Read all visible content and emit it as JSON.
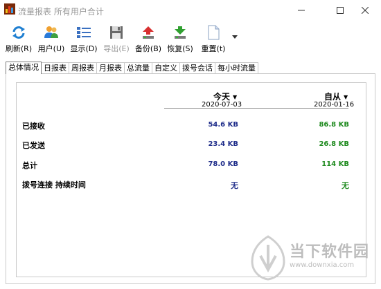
{
  "window": {
    "title": "流量报表 所有用户合计"
  },
  "toolbar": {
    "buttons": [
      {
        "label": "刷新(R)",
        "icon": "refresh-icon"
      },
      {
        "label": "用户(U)",
        "icon": "users-icon"
      },
      {
        "label": "显示(D)",
        "icon": "display-list-icon"
      },
      {
        "label": "导出(E)",
        "icon": "save-disk-icon",
        "disabled": true
      },
      {
        "label": "备份(B)",
        "icon": "backup-up-arrow-icon"
      },
      {
        "label": "恢复(S)",
        "icon": "restore-down-arrow-icon"
      },
      {
        "label": "重置(t)",
        "icon": "reset-document-icon"
      }
    ]
  },
  "tabs": [
    "总体情况",
    "日报表",
    "周报表",
    "月报表",
    "总流量",
    "自定义",
    "拨号会话",
    "每小时流量"
  ],
  "active_tab": "总体情况",
  "summary": {
    "col1": {
      "header": "今天",
      "date": "2020-07-03"
    },
    "col2": {
      "header": "自从",
      "date": "2020-01-16"
    },
    "rows": [
      {
        "label": "已接收",
        "v1": "54.6 KB",
        "v2": "86.8 KB"
      },
      {
        "label": "已发送",
        "v1": "23.4 KB",
        "v2": "26.8 KB"
      },
      {
        "label": "总计",
        "v1": "78.0 KB",
        "v2": "114 KB"
      },
      {
        "label": "拨号连接 持续时间",
        "v1": "无",
        "v2": "无"
      }
    ]
  },
  "watermark": {
    "title": "当下软件园",
    "url": "www.downxia.com"
  },
  "colors": {
    "value_blue": "#1f2d8a",
    "value_green": "#1e8a1e"
  }
}
